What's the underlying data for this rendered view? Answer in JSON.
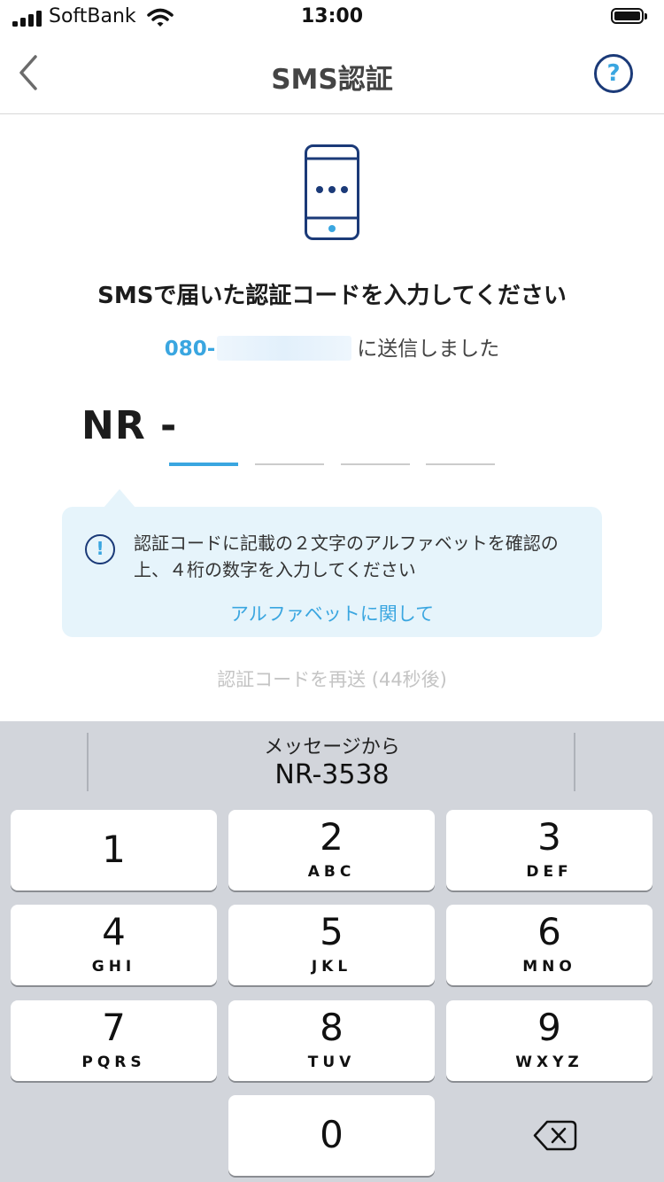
{
  "status_bar": {
    "carrier": "SoftBank",
    "time": "13:00"
  },
  "nav": {
    "title": "SMS認証",
    "help_symbol": "?"
  },
  "content": {
    "heading": "SMSで届いた認証コードを入力してください",
    "phone_prefix": "080-",
    "sent_text": "に送信しました",
    "code_prefix": "NR -",
    "info_symbol": "!",
    "info_text": "認証コードに記載の２文字のアルファベットを確認の上、４桁の数字を入力してください",
    "info_link": "アルファベットに関して",
    "resend": "認証コードを再送 (44秒後)"
  },
  "keyboard": {
    "suggestion_label": "メッセージから",
    "suggestion_value": "NR-3538",
    "keys": [
      {
        "digit": "1",
        "letters": ""
      },
      {
        "digit": "2",
        "letters": "ABC"
      },
      {
        "digit": "3",
        "letters": "DEF"
      },
      {
        "digit": "4",
        "letters": "GHI"
      },
      {
        "digit": "5",
        "letters": "JKL"
      },
      {
        "digit": "6",
        "letters": "MNO"
      },
      {
        "digit": "7",
        "letters": "PQRS"
      },
      {
        "digit": "8",
        "letters": "TUV"
      },
      {
        "digit": "9",
        "letters": "WXYZ"
      },
      {
        "digit": "0",
        "letters": ""
      }
    ]
  },
  "colors": {
    "accent": "#3aa6e0",
    "navy": "#1b3a78",
    "info_background": "#e6f4fb",
    "keyboard_background": "#d2d5db"
  }
}
